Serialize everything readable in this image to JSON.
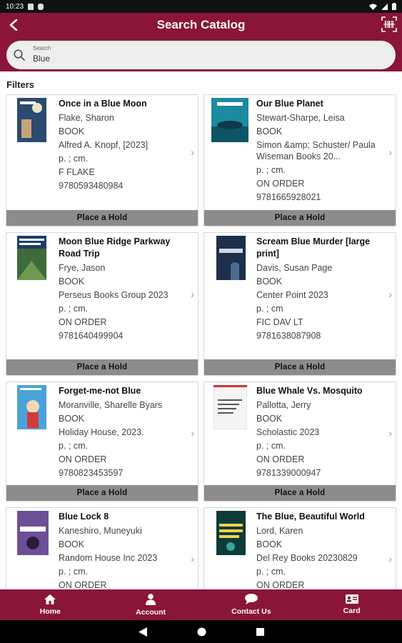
{
  "status_bar": {
    "time": "10:23"
  },
  "header": {
    "title": "Search Catalog"
  },
  "search": {
    "label": "Search",
    "value": "Blue"
  },
  "filters_label": "Filters",
  "hold_label": "Place a Hold",
  "books": [
    {
      "title": "Once in a Blue Moon",
      "author": "Flake, Sharon",
      "type": "BOOK",
      "publisher": "Alfred A. Knopf, [2023]",
      "physical": "p. ; cm.",
      "call_number": "F FLAKE",
      "isbn": "9780593480984",
      "cover_color": "#2b4a6f"
    },
    {
      "title": "Our Blue Planet",
      "author": "Stewart-Sharpe, Leisa",
      "type": "BOOK",
      "publisher": "Simon &amp; Schuster/ Paula Wiseman Books 20...",
      "physical": "p. ; cm.",
      "call_number": "ON ORDER",
      "isbn": "9781665928021",
      "cover_color": "#1e8aa0"
    },
    {
      "title": "Moon Blue Ridge Parkway Road Trip",
      "author": "Frye, Jason",
      "type": "BOOK",
      "publisher": "Perseus Books Group 2023",
      "physical": "p. ; cm.",
      "call_number": "ON ORDER",
      "isbn": "9781640499904",
      "cover_color": "#3d6b3a"
    },
    {
      "title": "Scream Blue Murder [large print]",
      "author": "Davis, Susan Page",
      "type": "BOOK",
      "publisher": "Center Point 2023",
      "physical": "p. ; cm",
      "call_number": "FIC DAV LT",
      "isbn": "9781638087908",
      "cover_color": "#1d2f4a"
    },
    {
      "title": "Forget-me-not Blue",
      "author": "Moranville, Sharelle Byars",
      "type": "BOOK",
      "publisher": "Holiday House, 2023.",
      "physical": "p. ; cm.",
      "call_number": "ON ORDER",
      "isbn": "9780823453597",
      "cover_color": "#4aa3d8"
    },
    {
      "title": "Blue Whale Vs. Mosquito",
      "author": "Pallotta, Jerry",
      "type": "BOOK",
      "publisher": "Scholastic 2023",
      "physical": "p. ; cm.",
      "call_number": "ON ORDER",
      "isbn": "9781339000947",
      "cover_color": "#f4f4f4"
    },
    {
      "title": "Blue Lock 8",
      "author": "Kaneshiro, Muneyuki",
      "type": "BOOK",
      "publisher": "Random House Inc 2023",
      "physical": "p. ; cm.",
      "call_number": "ON ORDER",
      "isbn": "",
      "cover_color": "#5a3c7a"
    },
    {
      "title": "The Blue, Beautiful World",
      "author": "Lord, Karen",
      "type": "BOOK",
      "publisher": "Del Rey Books 20230829",
      "physical": "p. ; cm.",
      "call_number": "ON ORDER",
      "isbn": "",
      "cover_color": "#0f3a3a"
    }
  ],
  "bottom_nav": [
    {
      "label": "Home",
      "icon": "home-icon"
    },
    {
      "label": "Account",
      "icon": "person-icon"
    },
    {
      "label": "Contact Us",
      "icon": "chat-icon"
    },
    {
      "label": "Card",
      "icon": "card-icon"
    }
  ],
  "colors": {
    "brand": "#8a1538",
    "hold_button": "#8c8c8c"
  }
}
